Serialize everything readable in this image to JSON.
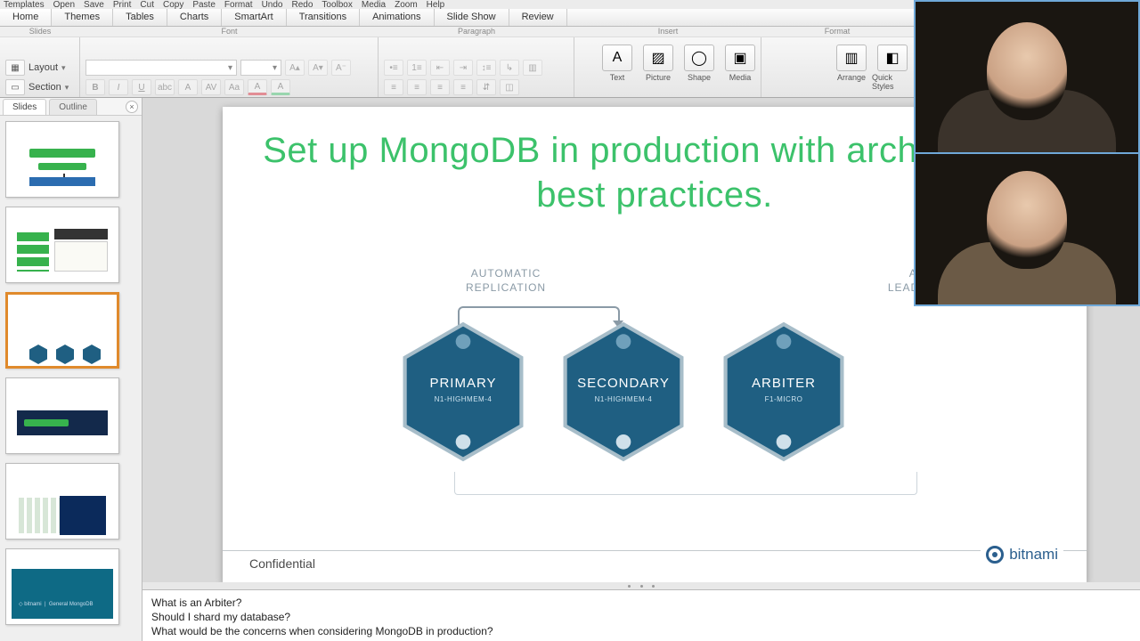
{
  "menubar": [
    "Templates",
    "Open",
    "Save",
    "Print",
    "Cut",
    "Copy",
    "Paste",
    "Format",
    "Undo",
    "Redo",
    "Toolbox",
    "Media",
    "Zoom",
    "Help"
  ],
  "ribbon_tabs": [
    "Home",
    "Themes",
    "Tables",
    "Charts",
    "SmartArt",
    "Transitions",
    "Animations",
    "Slide Show",
    "Review"
  ],
  "ribbon_active": 0,
  "group_headers": {
    "slides": "Slides",
    "font": "Font",
    "paragraph": "Paragraph",
    "insert": "Insert",
    "format": "Format"
  },
  "slides_group": {
    "layout": "Layout",
    "section": "Section"
  },
  "insert_tools": [
    {
      "label": "Text",
      "glyph": "A"
    },
    {
      "label": "Picture",
      "glyph": "▨"
    },
    {
      "label": "Shape",
      "glyph": "◯"
    },
    {
      "label": "Media",
      "glyph": "▣"
    }
  ],
  "format_tools": [
    {
      "label": "Arrange",
      "glyph": "▥"
    },
    {
      "label": "Quick Styles",
      "glyph": "◧"
    }
  ],
  "panel": {
    "tab_slides": "Slides",
    "tab_outline": "Outline"
  },
  "thumbs_count": 6,
  "selected_thumb": 3,
  "slide": {
    "title": "Set up MongoDB in production with architectural best practices.",
    "caption_replication_l1": "AUTOMATIC",
    "caption_replication_l2": "REPLICATION",
    "caption_election_l1": "AUTOMATIC",
    "caption_election_l2": "LEADER ELECTION",
    "nodes": [
      {
        "title": "PRIMARY",
        "sub": "N1-HIGHMEM-4"
      },
      {
        "title": "SECONDARY",
        "sub": "N1-HIGHMEM-4"
      },
      {
        "title": "ARBITER",
        "sub": "F1-MICRO"
      }
    ],
    "brand": "bitnami",
    "confidential": "Confidential"
  },
  "notes": [
    "What is an Arbiter?",
    "Should I shard my database?",
    "What would be the concerns when considering MongoDB in production?"
  ],
  "colors": {
    "accent": "#3cc26b",
    "hex_fill": "#1f5f82",
    "hex_stroke": "#a7bdc9"
  }
}
